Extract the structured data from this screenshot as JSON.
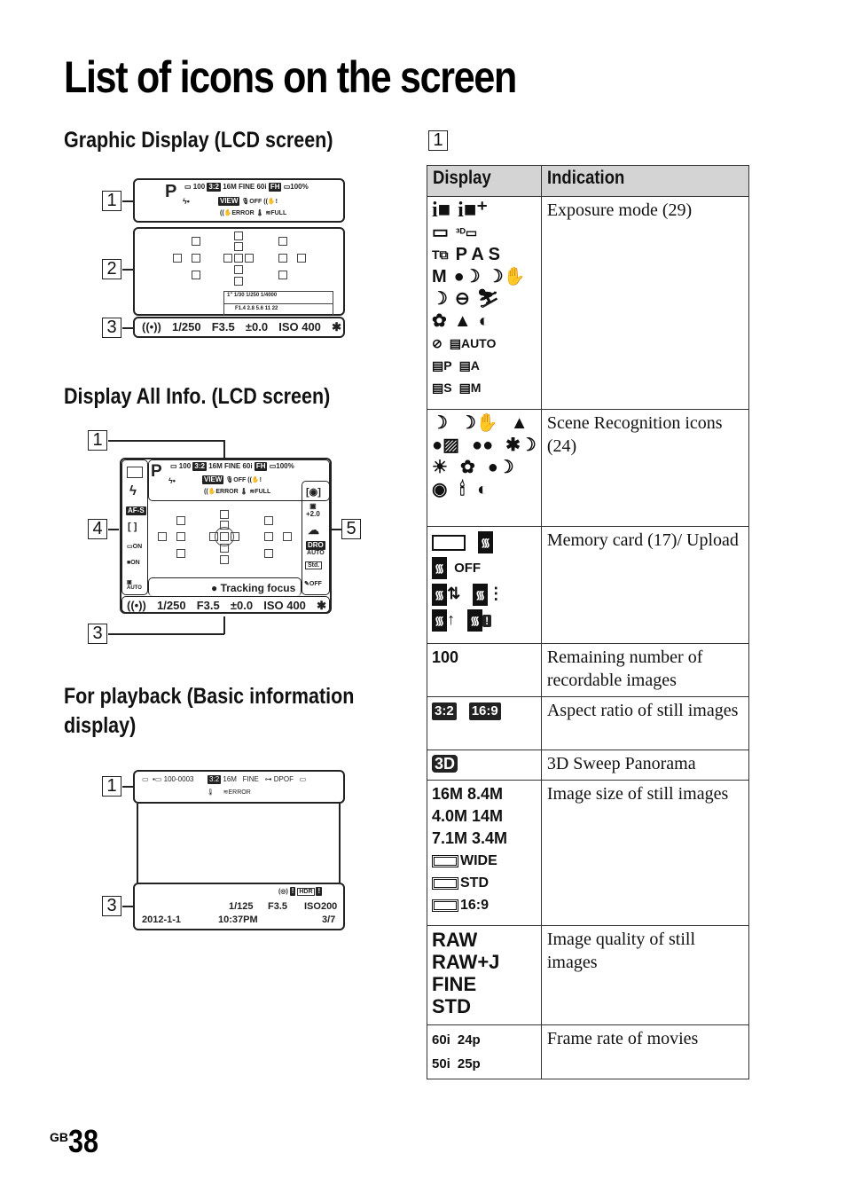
{
  "page": {
    "title": "List of icons on the screen",
    "page_prefix": "GB",
    "page_number": "38"
  },
  "sections": {
    "graphic_display": "Graphic Display (LCD screen)",
    "display_all_info": "Display All Info. (LCD screen)",
    "playback_line1": "For playback (Basic information",
    "playback_line2": "display)",
    "table_section_number": "1"
  },
  "callouts": [
    "1",
    "2",
    "3",
    "4",
    "5"
  ],
  "lcd_graphic": {
    "mode": "P",
    "remaining": "100",
    "aspect": "3:2",
    "size": "16M",
    "quality": "FINE",
    "frame_rate": "60i",
    "battery": "100%",
    "view": "VIEW",
    "shutter_scale": "1\"  1/30   1/250   1/4000",
    "aperture_scale": "F1.4  2.8  5.6  11  22",
    "bottom": {
      "shutter": "1/250",
      "aperture": "F3.5",
      "exposure": "±0.0",
      "iso": "ISO 400",
      "lock": "✱"
    }
  },
  "lcd_all_info": {
    "mode": "P",
    "remaining": "100",
    "aspect": "3:2",
    "size": "16M",
    "quality": "FINE",
    "frame_rate": "60i",
    "battery": "100%",
    "view": "VIEW",
    "left_column": [
      "AF-S",
      "[ ]",
      "ON",
      "ON",
      "AUTO"
    ],
    "right_column": [
      "+2.0",
      "DRO",
      "AUTO",
      "Std.",
      "OFF"
    ],
    "tracking": "● Tracking focus",
    "bottom": {
      "shutter": "1/250",
      "aperture": "F3.5",
      "exposure": "±0.0",
      "iso": "ISO 400",
      "lock": "✱"
    }
  },
  "lcd_playback": {
    "folder_file": "100-0003",
    "aspect": "3:2",
    "size": "16M",
    "quality": "FINE",
    "protect": "DPOF",
    "error": "ERROR",
    "shutter": "1/125",
    "aperture": "F3.5",
    "iso": "ISO200",
    "date": "2012-1-1",
    "time": "10:37PM",
    "counter": "3/7",
    "hdr": "HDR"
  },
  "table": {
    "headers": [
      "Display",
      "Indication"
    ],
    "rows": [
      {
        "display_lines": [
          [
            "iO",
            "iO+"
          ],
          [
            "▭",
            "3D▭"
          ],
          [
            "T7",
            "P A S"
          ],
          [
            "M",
            "☾",
            "☾✋"
          ],
          [
            "☾",
            "⊖",
            "🏃"
          ],
          [
            "🌷",
            "▲",
            "◐"
          ],
          [
            "⊘",
            "AUTO"
          ],
          [
            "P",
            "A"
          ],
          [
            "S",
            "M"
          ]
        ],
        "indication": "Exposure mode (29)"
      },
      {
        "display_lines": [
          [
            "☾",
            "☾✋",
            "▲"
          ],
          [
            "👤",
            "👥",
            "✿☾"
          ],
          [
            "☀",
            "🌷",
            "☾"
          ],
          [
            "◉",
            "🕯",
            "◐"
          ]
        ],
        "indication": "Scene Recognition icons (24)"
      },
      {
        "display_lines": [
          [
            "▭",
            "wifi"
          ],
          [
            "wifi-OFF"
          ],
          [
            "wifi-⇅",
            "wifi-⋮"
          ],
          [
            "wifi-↑",
            "wifi-!"
          ]
        ],
        "indication": "Memory card (17)/ Upload"
      },
      {
        "display_lines": [
          [
            "100"
          ]
        ],
        "indication": "Remaining number of recordable images"
      },
      {
        "display_lines": [
          [
            "3:2",
            "16:9"
          ]
        ],
        "indication": "Aspect ratio of still images"
      },
      {
        "display_lines": [
          [
            "3D"
          ]
        ],
        "indication": "3D Sweep Panorama"
      },
      {
        "display_lines": [
          [
            "16M 8.4M"
          ],
          [
            "4.0M 14M"
          ],
          [
            "7.1M 3.4M"
          ],
          [
            "WIDE"
          ],
          [
            "STD"
          ],
          [
            "16:9"
          ]
        ],
        "indication": "Image size of still images"
      },
      {
        "display_lines": [
          [
            "RAW"
          ],
          [
            "RAW+J"
          ],
          [
            "FINE"
          ],
          [
            "STD"
          ]
        ],
        "indication": "Image quality of still images"
      },
      {
        "display_lines": [
          [
            "60i",
            "24p"
          ],
          [
            "50i",
            "25p"
          ]
        ],
        "indication": "Frame rate of movies"
      }
    ]
  }
}
